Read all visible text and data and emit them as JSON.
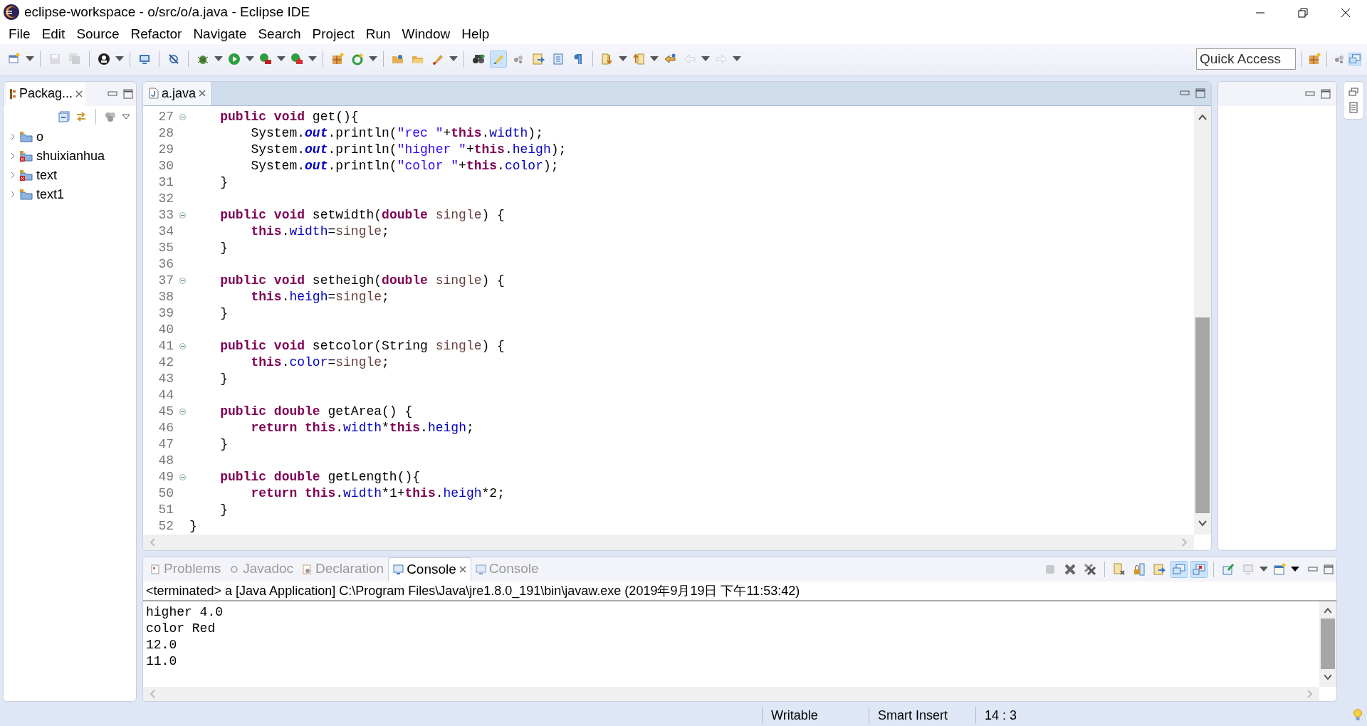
{
  "window": {
    "title": "eclipse-workspace - o/src/o/a.java - Eclipse IDE"
  },
  "menu": [
    "File",
    "Edit",
    "Source",
    "Refactor",
    "Navigate",
    "Search",
    "Project",
    "Run",
    "Window",
    "Help"
  ],
  "toolbar_buttons": [
    {
      "pressed": false,
      "disabled": false
    },
    {
      "pressed": false,
      "disabled": true
    },
    {
      "pressed": false,
      "disabled": true
    },
    {
      "pressed": false,
      "disabled": false
    },
    {
      "pressed": false,
      "disabled": false
    },
    {
      "pressed": false,
      "disabled": false
    },
    {
      "pressed": false,
      "disabled": false
    },
    {
      "pressed": false,
      "disabled": false
    },
    {
      "pressed": false,
      "disabled": false
    },
    {
      "pressed": false,
      "disabled": false
    },
    {
      "pressed": false,
      "disabled": false
    },
    {
      "pressed": false,
      "disabled": false
    },
    {
      "pressed": false,
      "disabled": false
    },
    {
      "pressed": false,
      "disabled": false
    },
    {
      "pressed": false,
      "disabled": false
    },
    {
      "pressed": false,
      "disabled": false
    },
    {
      "pressed": true,
      "disabled": false
    },
    {
      "pressed": false,
      "disabled": false
    },
    {
      "pressed": false,
      "disabled": false
    },
    {
      "pressed": false,
      "disabled": false
    },
    {
      "pressed": false,
      "disabled": false
    },
    {
      "pressed": false,
      "disabled": false
    },
    {
      "pressed": false,
      "disabled": false
    },
    {
      "pressed": false,
      "disabled": false
    },
    {
      "pressed": false,
      "disabled": true
    },
    {
      "pressed": false,
      "disabled": true
    }
  ],
  "quick_access": {
    "placeholder": "Quick Access"
  },
  "package_explorer": {
    "tab": "Packag...",
    "projects": [
      {
        "name": "o",
        "expanded": false,
        "error": false
      },
      {
        "name": "shuixianhua",
        "expanded": false,
        "error": true
      },
      {
        "name": "text",
        "expanded": false,
        "error": true
      },
      {
        "name": "text1",
        "expanded": false,
        "error": false
      }
    ]
  },
  "editor": {
    "tab": "a.java",
    "lines": [
      {
        "number": "27",
        "fold": true,
        "tokens": [
          {
            "kind": "keyword",
            "text": "    public"
          },
          {
            "kind": "keyword",
            "text": " void"
          },
          {
            "kind": "plain",
            "text": " get(){"
          }
        ]
      },
      {
        "number": "28",
        "fold": false,
        "tokens": [
          {
            "kind": "plain",
            "text": "        System."
          },
          {
            "kind": "static",
            "text": "out"
          },
          {
            "kind": "plain",
            "text": ".println("
          },
          {
            "kind": "string",
            "text": "\"rec \""
          },
          {
            "kind": "plain",
            "text": "+"
          },
          {
            "kind": "keyword",
            "text": "this"
          },
          {
            "kind": "plain",
            "text": "."
          },
          {
            "kind": "field",
            "text": "width"
          },
          {
            "kind": "plain",
            "text": ");"
          }
        ]
      },
      {
        "number": "29",
        "fold": false,
        "tokens": [
          {
            "kind": "plain",
            "text": "        System."
          },
          {
            "kind": "static",
            "text": "out"
          },
          {
            "kind": "plain",
            "text": ".println("
          },
          {
            "kind": "string",
            "text": "\"higher \""
          },
          {
            "kind": "plain",
            "text": "+"
          },
          {
            "kind": "keyword",
            "text": "this"
          },
          {
            "kind": "plain",
            "text": "."
          },
          {
            "kind": "field",
            "text": "heigh"
          },
          {
            "kind": "plain",
            "text": ");"
          }
        ]
      },
      {
        "number": "30",
        "fold": false,
        "tokens": [
          {
            "kind": "plain",
            "text": "        System."
          },
          {
            "kind": "static",
            "text": "out"
          },
          {
            "kind": "plain",
            "text": ".println("
          },
          {
            "kind": "string",
            "text": "\"color \""
          },
          {
            "kind": "plain",
            "text": "+"
          },
          {
            "kind": "keyword",
            "text": "this"
          },
          {
            "kind": "plain",
            "text": "."
          },
          {
            "kind": "field",
            "text": "color"
          },
          {
            "kind": "plain",
            "text": ");"
          }
        ]
      },
      {
        "number": "31",
        "fold": false,
        "tokens": [
          {
            "kind": "plain",
            "text": "    }"
          }
        ]
      },
      {
        "number": "32",
        "fold": false
      },
      {
        "number": "33",
        "fold": true,
        "tokens": [
          {
            "kind": "keyword",
            "text": "    public"
          },
          {
            "kind": "keyword",
            "text": " void"
          },
          {
            "kind": "plain",
            "text": " setwidth("
          },
          {
            "kind": "keyword",
            "text": "double"
          },
          {
            "kind": "param",
            "text": " single"
          },
          {
            "kind": "plain",
            "text": ") {"
          }
        ]
      },
      {
        "number": "34",
        "fold": false,
        "tokens": [
          {
            "kind": "keyword",
            "text": "        this"
          },
          {
            "kind": "plain",
            "text": "."
          },
          {
            "kind": "field",
            "text": "width"
          },
          {
            "kind": "plain",
            "text": "="
          },
          {
            "kind": "param",
            "text": "single"
          },
          {
            "kind": "plain",
            "text": ";"
          }
        ]
      },
      {
        "number": "35",
        "fold": false,
        "tokens": [
          {
            "kind": "plain",
            "text": "    }"
          }
        ]
      },
      {
        "number": "36",
        "fold": false
      },
      {
        "number": "37",
        "fold": true,
        "tokens": [
          {
            "kind": "keyword",
            "text": "    public"
          },
          {
            "kind": "keyword",
            "text": " void"
          },
          {
            "kind": "plain",
            "text": " setheigh("
          },
          {
            "kind": "keyword",
            "text": "double"
          },
          {
            "kind": "param",
            "text": " single"
          },
          {
            "kind": "plain",
            "text": ") {"
          }
        ]
      },
      {
        "number": "38",
        "fold": false,
        "tokens": [
          {
            "kind": "keyword",
            "text": "        this"
          },
          {
            "kind": "plain",
            "text": "."
          },
          {
            "kind": "field",
            "text": "heigh"
          },
          {
            "kind": "plain",
            "text": "="
          },
          {
            "kind": "param",
            "text": "single"
          },
          {
            "kind": "plain",
            "text": ";"
          }
        ]
      },
      {
        "number": "39",
        "fold": false,
        "tokens": [
          {
            "kind": "plain",
            "text": "    }"
          }
        ]
      },
      {
        "number": "40",
        "fold": false
      },
      {
        "number": "41",
        "fold": true,
        "tokens": [
          {
            "kind": "keyword",
            "text": "    public"
          },
          {
            "kind": "keyword",
            "text": " void"
          },
          {
            "kind": "plain",
            "text": " setcolor(String "
          },
          {
            "kind": "param",
            "text": "single"
          },
          {
            "kind": "plain",
            "text": ") {"
          }
        ]
      },
      {
        "number": "42",
        "fold": false,
        "tokens": [
          {
            "kind": "keyword",
            "text": "        this"
          },
          {
            "kind": "plain",
            "text": "."
          },
          {
            "kind": "field",
            "text": "color"
          },
          {
            "kind": "plain",
            "text": "="
          },
          {
            "kind": "param",
            "text": "single"
          },
          {
            "kind": "plain",
            "text": ";"
          }
        ]
      },
      {
        "number": "43",
        "fold": false,
        "tokens": [
          {
            "kind": "plain",
            "text": "    }"
          }
        ]
      },
      {
        "number": "44",
        "fold": false
      },
      {
        "number": "45",
        "fold": true,
        "tokens": [
          {
            "kind": "keyword",
            "text": "    public"
          },
          {
            "kind": "keyword",
            "text": " double"
          },
          {
            "kind": "plain",
            "text": " getArea() {"
          }
        ]
      },
      {
        "number": "46",
        "fold": false,
        "tokens": [
          {
            "kind": "keyword",
            "text": "        return"
          },
          {
            "kind": "keyword",
            "text": " this"
          },
          {
            "kind": "plain",
            "text": "."
          },
          {
            "kind": "field",
            "text": "width"
          },
          {
            "kind": "plain",
            "text": "*"
          },
          {
            "kind": "keyword",
            "text": "this"
          },
          {
            "kind": "plain",
            "text": "."
          },
          {
            "kind": "field",
            "text": "heigh"
          },
          {
            "kind": "plain",
            "text": ";"
          }
        ]
      },
      {
        "number": "47",
        "fold": false,
        "tokens": [
          {
            "kind": "plain",
            "text": "    }"
          }
        ]
      },
      {
        "number": "48",
        "fold": false
      },
      {
        "number": "49",
        "fold": true,
        "tokens": [
          {
            "kind": "keyword",
            "text": "    public"
          },
          {
            "kind": "keyword",
            "text": " double"
          },
          {
            "kind": "plain",
            "text": " getLength(){"
          }
        ]
      },
      {
        "number": "50",
        "fold": false,
        "tokens": [
          {
            "kind": "keyword",
            "text": "        return"
          },
          {
            "kind": "keyword",
            "text": " this"
          },
          {
            "kind": "plain",
            "text": "."
          },
          {
            "kind": "field",
            "text": "width"
          },
          {
            "kind": "plain",
            "text": "*1+"
          },
          {
            "kind": "keyword",
            "text": "this"
          },
          {
            "kind": "plain",
            "text": "."
          },
          {
            "kind": "field",
            "text": "heigh"
          },
          {
            "kind": "plain",
            "text": "*2;"
          }
        ]
      },
      {
        "number": "51",
        "fold": false,
        "tokens": [
          {
            "kind": "plain",
            "text": "    }"
          }
        ]
      },
      {
        "number": "52",
        "fold": false,
        "tokens": [
          {
            "kind": "plain",
            "text": "}"
          }
        ]
      }
    ]
  },
  "bottom_tabs": [
    {
      "label": "Problems",
      "selected": false
    },
    {
      "label": "Javadoc",
      "selected": false
    },
    {
      "label": "Declaration",
      "selected": false
    },
    {
      "label": "Console",
      "selected": true
    },
    {
      "label": "Console",
      "selected": false
    }
  ],
  "console_buttons": [
    {
      "pressed": false,
      "disabled": true
    },
    {
      "pressed": false,
      "disabled": false
    },
    {
      "pressed": false,
      "disabled": false
    },
    {
      "pressed": false,
      "disabled": false
    },
    {
      "pressed": false,
      "disabled": false
    },
    {
      "pressed": false,
      "disabled": false
    },
    {
      "pressed": true,
      "disabled": false
    },
    {
      "pressed": true,
      "disabled": false
    },
    {
      "pressed": false,
      "disabled": false
    },
    {
      "pressed": false,
      "disabled": true
    },
    {
      "pressed": false,
      "disabled": false
    }
  ],
  "console": {
    "header": "<terminated> a [Java Application] C:\\Program Files\\Java\\jre1.8.0_191\\bin\\javaw.exe (2019年9月19日 下午11:53:42)",
    "output": [
      "higher 4.0",
      "color Red",
      "12.0",
      "11.0"
    ]
  },
  "status_bar": [
    "Writable",
    "Smart Insert",
    "14 : 3"
  ]
}
